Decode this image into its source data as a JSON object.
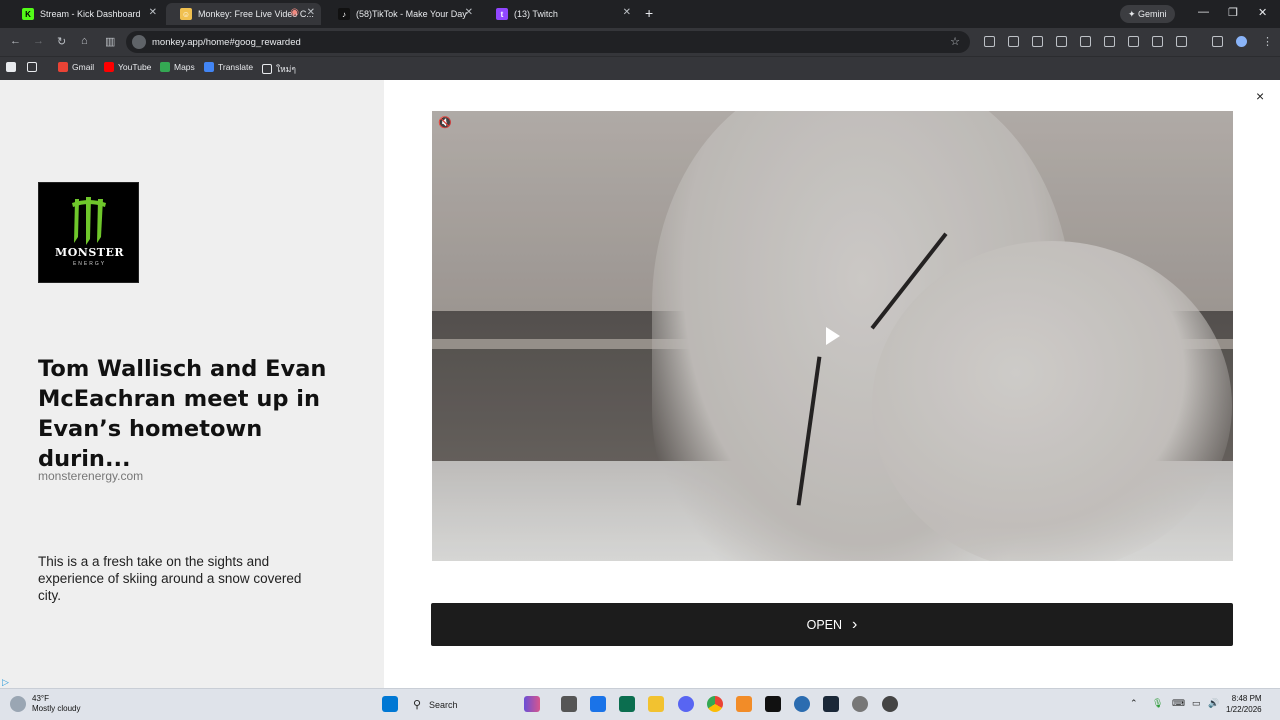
{
  "browser": {
    "tabs": [
      {
        "title": "Stream - Kick Dashboard",
        "favicon_color": "#53fc18",
        "favicon_glyph": "K"
      },
      {
        "title": "Monkey: Free Live Video C...",
        "favicon_color": "#f0c050",
        "favicon_glyph": "☺",
        "recording_indicator": "◉"
      },
      {
        "title": "(58)TikTok - Make Your Day",
        "favicon_color": "#111111",
        "favicon_glyph": "♪"
      },
      {
        "title": "(13) Twitch",
        "favicon_color": "#9146ff",
        "favicon_glyph": "t"
      }
    ],
    "gemini_label": "Gemini",
    "url": "monkey.app/home#goog_rewarded",
    "bookmarks": [
      {
        "label": "Gmail",
        "color": "#ea4335"
      },
      {
        "label": "YouTube",
        "color": "#ff0000"
      },
      {
        "label": "Maps",
        "color": "#34a853"
      },
      {
        "label": "Translate",
        "color": "#4285f4"
      },
      {
        "label": "ใหม่ๆ",
        "icon": "folder-icon"
      }
    ]
  },
  "ad": {
    "brand_logo": {
      "wordmark": "MONSTER",
      "sub": "ENERGY",
      "color": "#6fc72b"
    },
    "title": "Tom Wallisch and Evan McEachran meet up in Evan’s hometown durin...",
    "domain": "monsterenergy.com",
    "description": "This is a a fresh take on the sights and experience of skiing around a snow covered city.",
    "cta_label": "OPEN",
    "close_glyph": "×",
    "adchoices_glyph": "▷"
  },
  "taskbar": {
    "weather_temp": "43°F",
    "weather_desc": "Mostly cloudy",
    "search_label": "Search",
    "time": "8:48 PM",
    "date": "1/22/2026"
  }
}
